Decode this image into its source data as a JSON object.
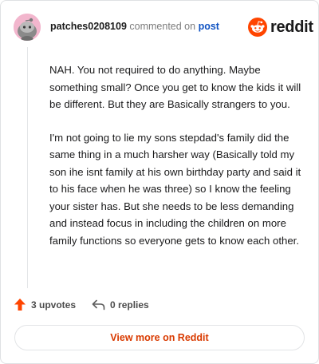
{
  "comment": {
    "username": "patches0208109",
    "action_text": "commented on",
    "post_link": "post",
    "paragraphs": [
      "NAH. You not required to do anything. Maybe something small? Once you get to know the kids it will be different. But they are Basically strangers to you.",
      "I'm not going to lie my sons stepdad's family did the same thing in a much harsher way (Basically told my son ihe isnt family at his own birthday party and said it to his face when he was three) so I know the feeling your sister has. But she needs to be less demanding and instead focus in including the children on more family functions so everyone gets to know each other."
    ],
    "upvotes_label": "3 upvotes",
    "replies_label": "0 replies",
    "view_button": "View more on Reddit"
  },
  "brand": {
    "wordmark": "reddit",
    "icon": "reddit-snoo-icon",
    "color": "#ff4500"
  },
  "icons": {
    "avatar": "snoo-avatar-icon",
    "upvote": "upvote-arrow-icon",
    "reply": "reply-arrow-icon"
  },
  "colors": {
    "accent": "#ff4500",
    "link": "#0f52c2",
    "button_text": "#d93a00",
    "avatar_bg": "#f2b6cd"
  }
}
